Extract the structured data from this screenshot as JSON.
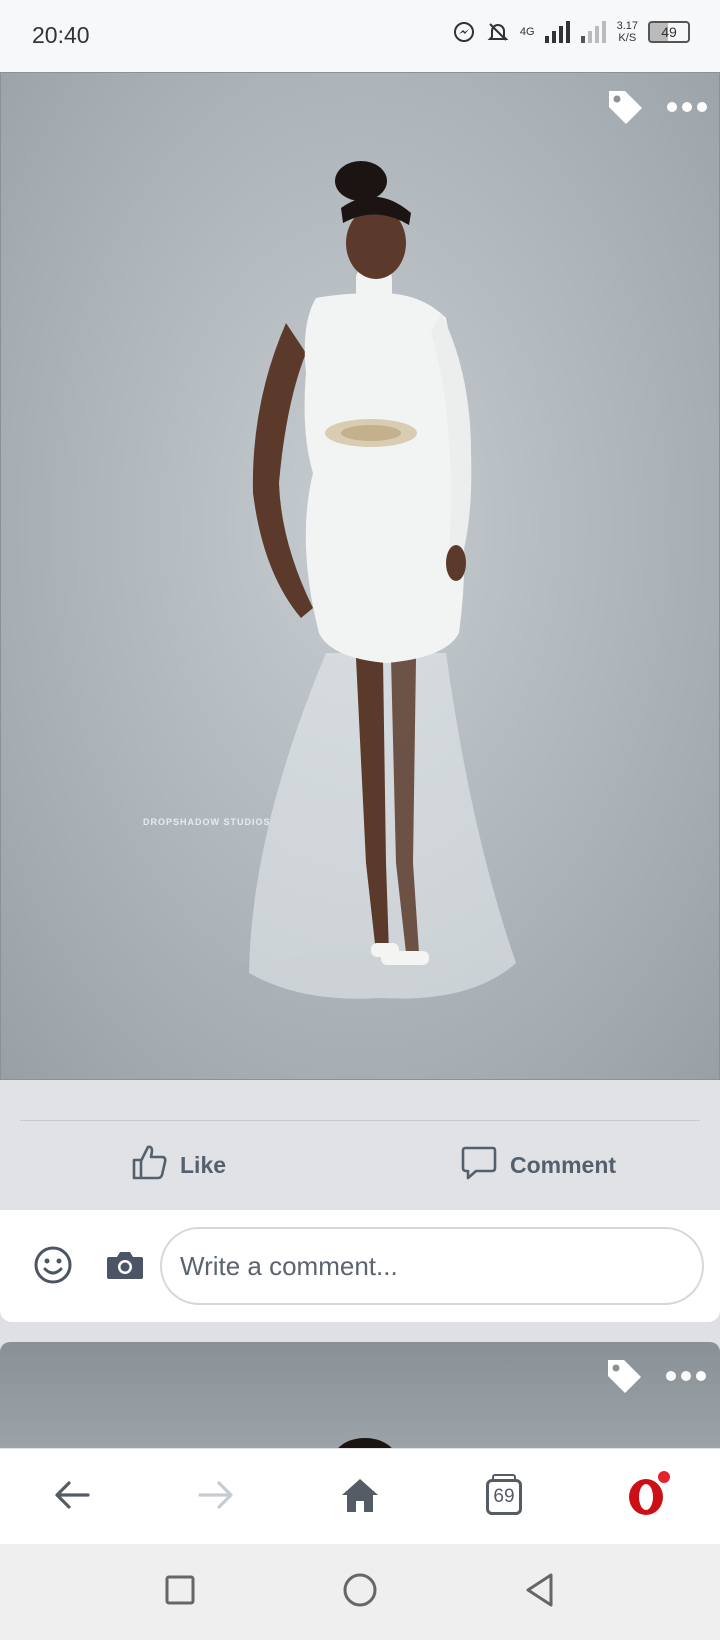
{
  "status_bar": {
    "time": "20:40",
    "network_type": "4G",
    "net_speed_value": "3.17",
    "net_speed_unit": "K/S",
    "battery_level": "49"
  },
  "post": {
    "watermark": "DROPSHADOW STUDIOS",
    "tag_icon": "tag-icon",
    "more_icon": "more-options-icon"
  },
  "actions": {
    "like_label": "Like",
    "comment_label": "Comment"
  },
  "comment_bar": {
    "placeholder": "Write a comment...",
    "emoji_icon": "emoji-icon",
    "camera_icon": "camera-icon"
  },
  "browser_bar": {
    "tab_count": "69",
    "colors": {
      "opera_red": "#cc0f16",
      "notification_dot": "#e0242a"
    }
  },
  "colors": {
    "action_text": "#55606e",
    "actions_bg": "#e1e2e6"
  }
}
